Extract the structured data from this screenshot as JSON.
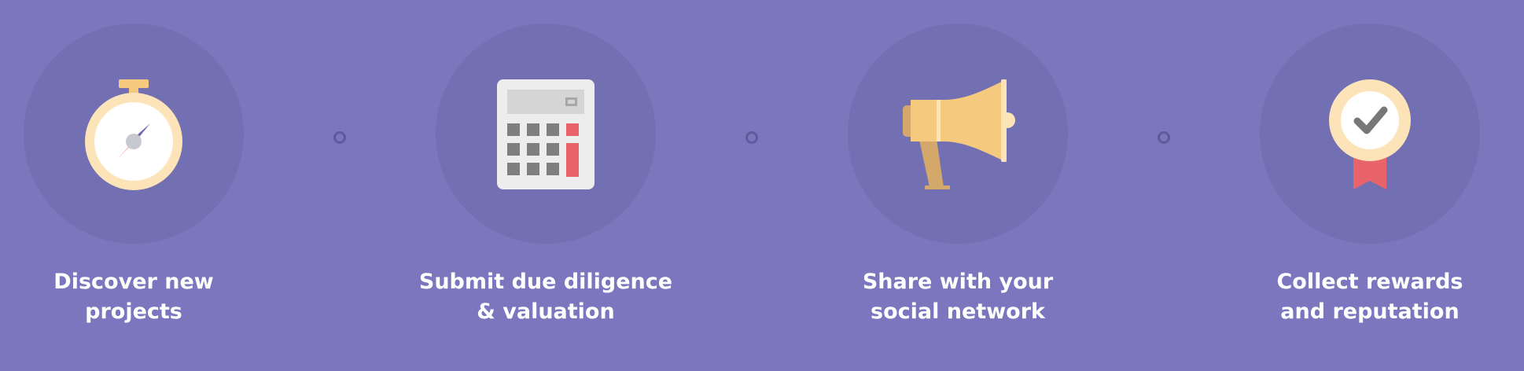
{
  "steps": [
    {
      "icon": "stopwatch-icon",
      "label_lines": [
        "Discover new",
        "projects"
      ]
    },
    {
      "icon": "calculator-icon",
      "label_lines": [
        "Submit due diligence",
        "& valuation"
      ]
    },
    {
      "icon": "megaphone-icon",
      "label_lines": [
        "Share with your",
        "social network"
      ]
    },
    {
      "icon": "award-badge-icon",
      "label_lines": [
        "Collect rewards",
        "and reputation"
      ]
    }
  ],
  "colors": {
    "background": "#7b76bd",
    "circle": "#7270b2",
    "connector": "#5f5b9d",
    "text": "#ffffff",
    "accent_yellow": "#f5c97e",
    "accent_cream": "#fde3b8",
    "accent_red": "#e8646a"
  }
}
